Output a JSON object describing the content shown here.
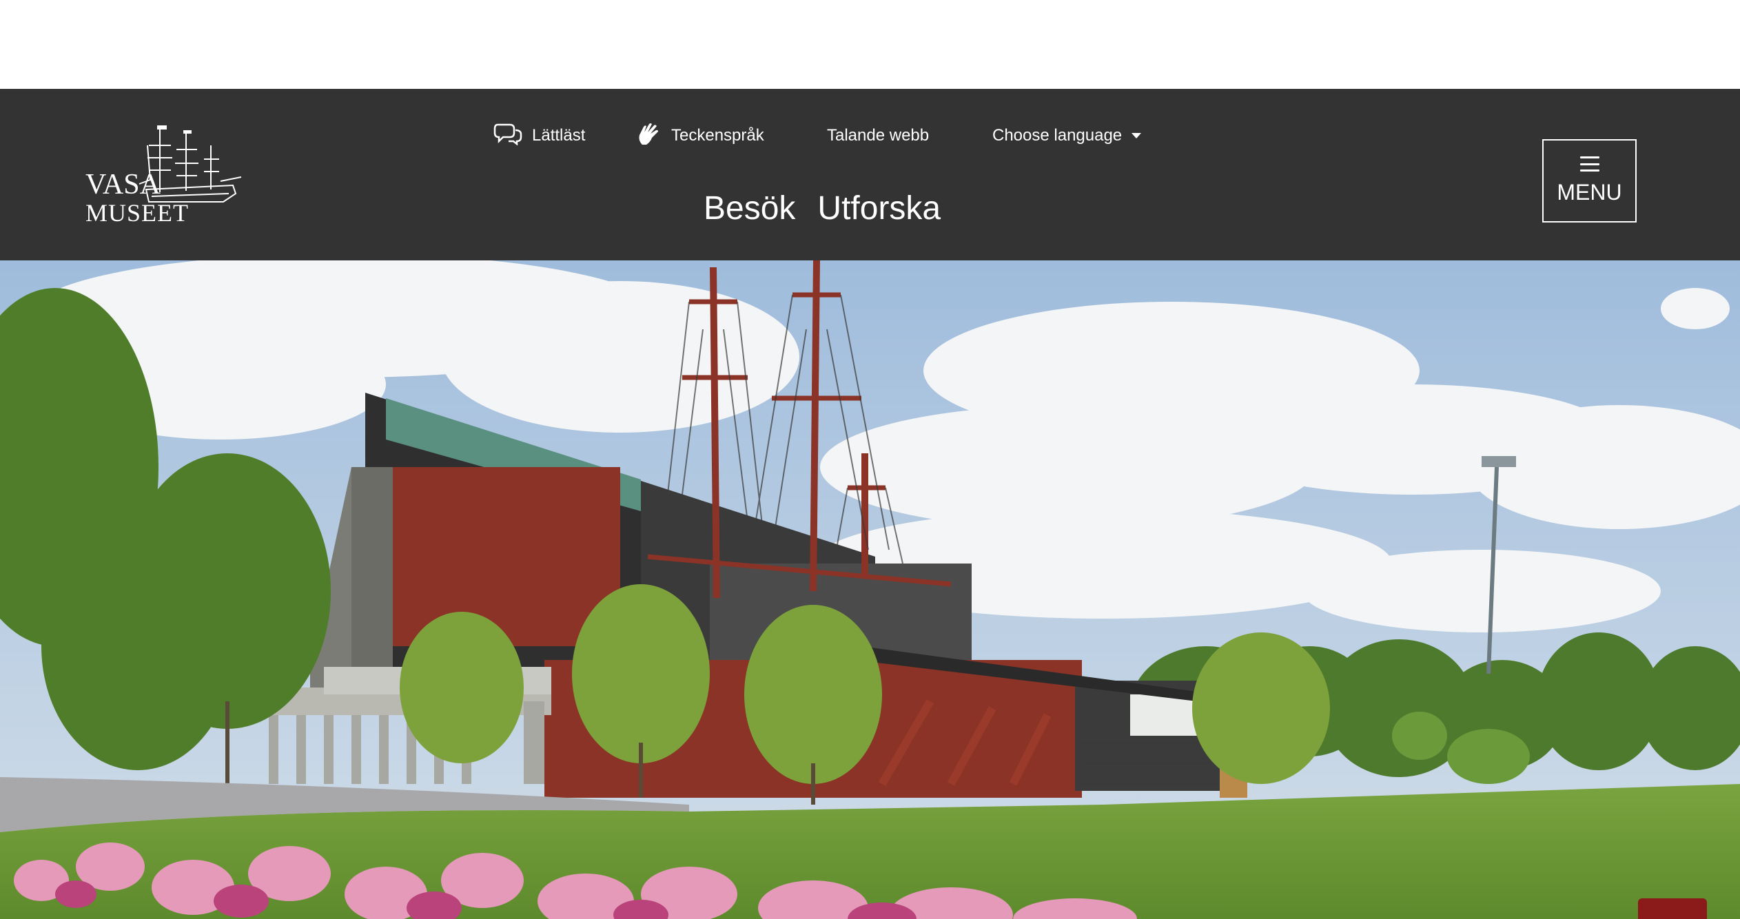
{
  "header": {
    "logo": {
      "line1": "VASA",
      "line2": "MUSEET"
    },
    "utility_nav": [
      {
        "label": "Lättläst",
        "icon": "speech-bubbles-icon"
      },
      {
        "label": "Teckenspråk",
        "icon": "sign-language-hand-icon"
      },
      {
        "label": "Talande webb"
      },
      {
        "label": "Choose language",
        "icon": "caret-down-icon"
      }
    ],
    "main_nav": [
      {
        "label": "Besök"
      },
      {
        "label": "Utforska"
      }
    ],
    "menu_button": {
      "label": "MENU",
      "icon": "hamburger-icon"
    }
  },
  "hero": {
    "image_alt": "",
    "colors": {
      "sky": "#b9cde3",
      "grass": "#6e9a3a",
      "building_red": "#8a3326",
      "building_dark": "#3a3a3a"
    }
  },
  "colors": {
    "header_bg": "#333333",
    "header_text": "#ffffff",
    "accent_tab": "#8b1a1a"
  }
}
